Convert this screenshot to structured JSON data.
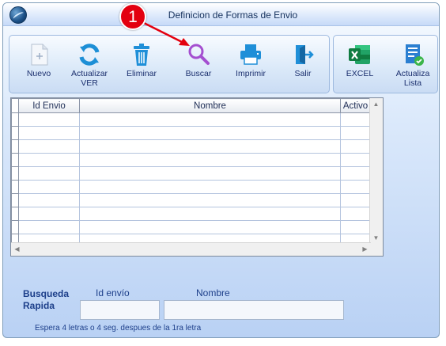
{
  "window": {
    "title": "Definicion de Formas de Envio"
  },
  "toolbar": {
    "nuevo": "Nuevo",
    "actualizar_line1": "Actualizar",
    "actualizar_line2": "VER",
    "eliminar": "Eliminar",
    "buscar": "Buscar",
    "imprimir": "Imprimir",
    "salir": "Salir",
    "excel": "EXCEL",
    "actualiza_line1": "Actualiza",
    "actualiza_line2": "Lista"
  },
  "grid": {
    "columns": [
      "Id Envio",
      "Nombre",
      "Activo"
    ],
    "rows": [
      [
        "",
        "",
        ""
      ],
      [
        "",
        "",
        ""
      ],
      [
        "",
        "",
        ""
      ],
      [
        "",
        "",
        ""
      ],
      [
        "",
        "",
        ""
      ],
      [
        "",
        "",
        ""
      ],
      [
        "",
        "",
        ""
      ],
      [
        "",
        "",
        ""
      ],
      [
        "",
        "",
        ""
      ],
      [
        "",
        "",
        ""
      ]
    ]
  },
  "search": {
    "title_line1": "Busqueda",
    "title_line2": "Rapida",
    "id_label": "Id envío",
    "name_label": "Nombre",
    "id_value": "",
    "name_value": "",
    "hint": "Espera 4 letras o 4 seg. despues de la 1ra letra"
  },
  "annotation": {
    "step": "1",
    "color": "#e3000f"
  }
}
